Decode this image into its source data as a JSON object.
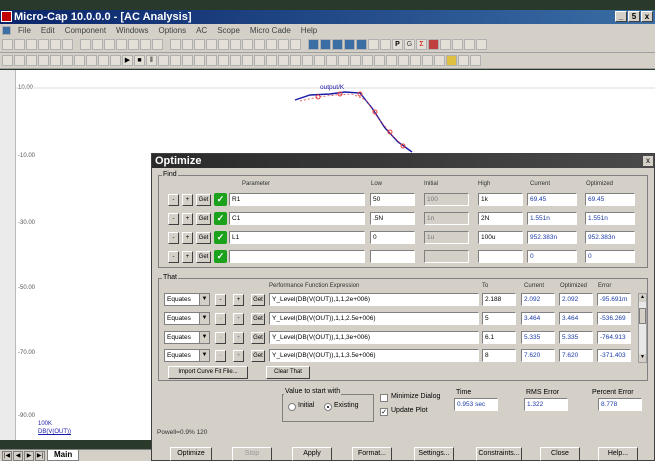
{
  "window": {
    "title": "Micro-Cap 10.0.0.0 - [AC Analysis]"
  },
  "menu": [
    "File",
    "Edit",
    "Component",
    "Windows",
    "Options",
    "AC",
    "Scope",
    "Micro Cade",
    "Help"
  ],
  "toolbar_icons": {
    "page_glyph": "P",
    "gear_glyph": "G",
    "sigma_glyph": "Σ"
  },
  "plot": {
    "trace_label": "output/K",
    "y_ticks": [
      "10.00",
      "-10.00",
      "-30.00",
      "-50.00",
      "-70.00",
      "-90.00"
    ],
    "x_tick": "100K",
    "x_label": "DB(V(OUT))"
  },
  "tabs": {
    "active": "Main"
  },
  "status": {
    "text": "Powell=0.9% 120"
  },
  "dialog": {
    "title": "Optimize",
    "find": {
      "label": "Find",
      "headers": {
        "parameter": "Parameter",
        "low": "Low",
        "initial": "Initial",
        "high": "High",
        "current": "Current",
        "optimized": "Optimized"
      },
      "rows": [
        {
          "parameter": "R1",
          "low": "50",
          "initial": "100",
          "high": "1k",
          "current": "69.45",
          "optimized": "69.45"
        },
        {
          "parameter": "C1",
          "low": ".5N",
          "initial": "1n",
          "high": "2N",
          "current": "1.551n",
          "optimized": "1.551n"
        },
        {
          "parameter": "L1",
          "low": "0",
          "initial": "1u",
          "high": "100u",
          "current": "952.383n",
          "optimized": "952.383n"
        },
        {
          "parameter": "",
          "low": "",
          "initial": "",
          "high": "",
          "current": "0",
          "optimized": "0"
        }
      ]
    },
    "that": {
      "label": "That",
      "headers": {
        "expression": "Performance Function Expression",
        "to": "To",
        "current": "Current",
        "optimized": "Optimized",
        "error": "Error"
      },
      "rows": [
        {
          "mode": "Equates",
          "expression": "Y_Level(DB(V(OUT)),1,1,2e+006)",
          "to": "2.188",
          "current": "2.092",
          "optimized": "2.092",
          "error": "-95.691m"
        },
        {
          "mode": "Equates",
          "expression": "Y_Level(DB(V(OUT)),1,1,2.5e+006)",
          "to": "5",
          "current": "3.464",
          "optimized": "3.464",
          "error": "-536.269"
        },
        {
          "mode": "Equates",
          "expression": "Y_Level(DB(V(OUT)),1,1,3e+006)",
          "to": "6.1",
          "current": "5.335",
          "optimized": "5.335",
          "error": "-764.913"
        },
        {
          "mode": "Equates",
          "expression": "Y_Level(DB(V(OUT)),1,1,3.5e+006)",
          "to": "8",
          "current": "7.620",
          "optimized": "7.620",
          "error": "-371.403"
        }
      ]
    },
    "buttons": {
      "minus": "-",
      "plus": "+",
      "get": "Get",
      "import_curve": "Import Curve Fit File...",
      "clear_that": "Clear That"
    },
    "value_start": {
      "label": "Value to start with",
      "initial": "Initial",
      "existing": "Existing"
    },
    "checks": {
      "minimize": "Minimize Dialog",
      "update_plot": "Update Plot"
    },
    "time": {
      "label": "Time",
      "value": "0.953 sec"
    },
    "rms": {
      "label": "RMS Error",
      "value": "1.322"
    },
    "pct": {
      "label": "Percent Error",
      "value": "8.778"
    },
    "bottom": [
      "Optimize",
      "Stop",
      "Apply",
      "Format...",
      "Settings...",
      "Constraints...",
      "Close",
      "Help..."
    ]
  },
  "colors": {
    "titlebar": "#0a246a",
    "trace": "#1a1aa8",
    "marker": "#e04040",
    "check": "#1ba11b"
  }
}
